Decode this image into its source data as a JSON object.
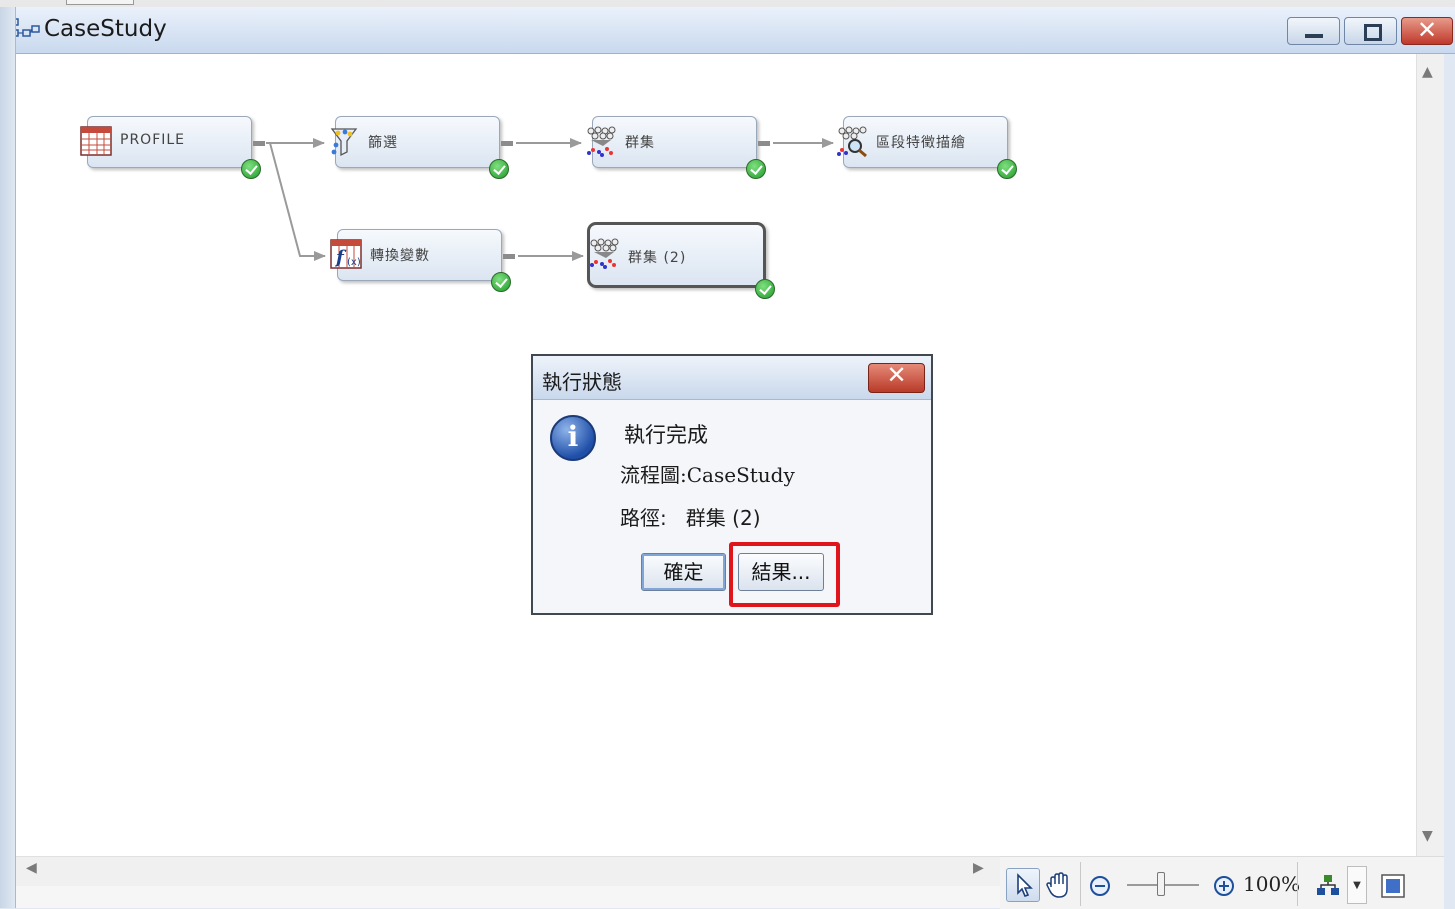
{
  "window": {
    "title": "CaseStudy",
    "controls": {
      "minimize_icon": "minimize-icon",
      "maximize_icon": "maximize-icon",
      "close_symbol": "✕"
    }
  },
  "flow_nodes": [
    {
      "id": "profile",
      "label": "PROFILE",
      "icon": "data-table-icon",
      "status": "completed"
    },
    {
      "id": "filter",
      "label": "篩選",
      "icon": "filter-icon",
      "status": "completed"
    },
    {
      "id": "cluster",
      "label": "群集",
      "icon": "cluster-icon",
      "status": "completed"
    },
    {
      "id": "segment-profile",
      "label": "區段特徵描繪",
      "icon": "segment-profile-icon",
      "status": "completed"
    },
    {
      "id": "transform",
      "label": "轉換變數",
      "icon": "transform-variables-icon",
      "status": "completed"
    },
    {
      "id": "cluster2",
      "label": "群集 (2)",
      "icon": "cluster-icon",
      "status": "completed",
      "selected": true
    }
  ],
  "connections": [
    [
      "profile",
      "filter"
    ],
    [
      "filter",
      "cluster"
    ],
    [
      "cluster",
      "segment-profile"
    ],
    [
      "profile",
      "transform"
    ],
    [
      "transform",
      "cluster2"
    ]
  ],
  "dialog": {
    "title": "執行狀態",
    "close_symbol": "✕",
    "icon": "info-icon",
    "icon_glyph": "i",
    "message": "執行完成",
    "flow_line": "流程圖:CaseStudy",
    "path_line": "路徑:   群集 (2)",
    "ok_button": "確定",
    "results_button": "結果...",
    "highlighted": "results_button",
    "highlight_color": "#e0141b"
  },
  "scrollbars": {
    "up": "▲",
    "down": "▼",
    "left": "◀",
    "right": "▶"
  },
  "toolbar": {
    "select_icon": "pointer-icon",
    "pan_icon": "hand-pan-icon",
    "zoom_out_icon": "zoom-out-icon",
    "zoom_in_icon": "zoom-in-icon",
    "zoom_level": "100%",
    "layout_icon": "auto-layout-icon",
    "dropdown_symbol": "▼",
    "fit_icon": "fit-to-window-icon"
  }
}
